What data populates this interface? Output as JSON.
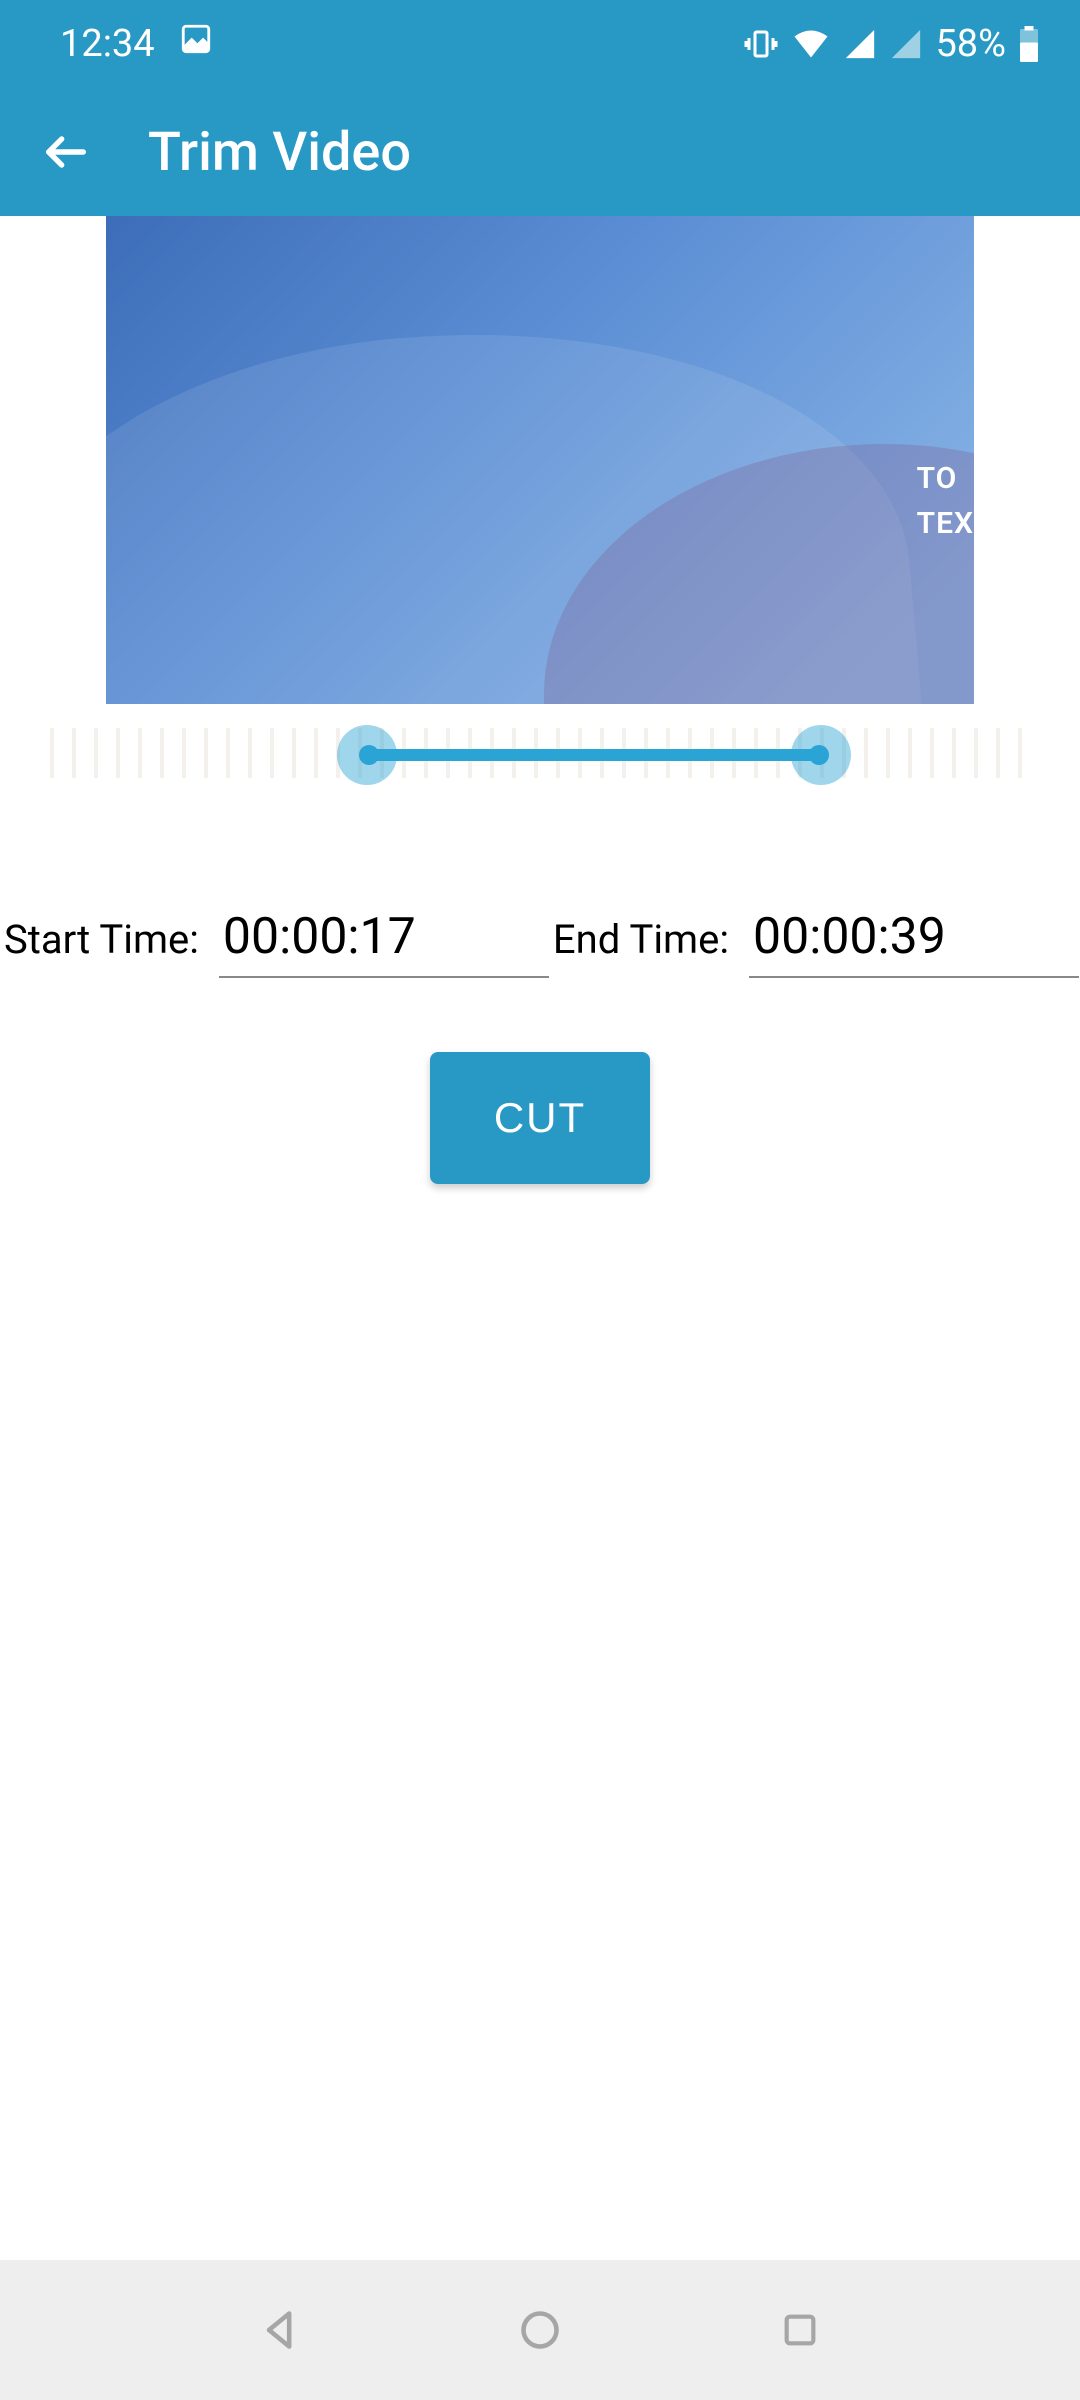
{
  "status": {
    "time": "12:34",
    "battery_pct": "58%"
  },
  "header": {
    "title": "Trim Video"
  },
  "preview": {
    "overlay_line1": "TO ",
    "overlay_line2": "TEX"
  },
  "slider": {
    "start_pct": 34,
    "end_pct": 76
  },
  "times": {
    "start_label": "Start Time:",
    "start_value": "00:00:17",
    "end_label": "End Time:",
    "end_value": "00:00:39"
  },
  "actions": {
    "cut_label": "CUT"
  }
}
